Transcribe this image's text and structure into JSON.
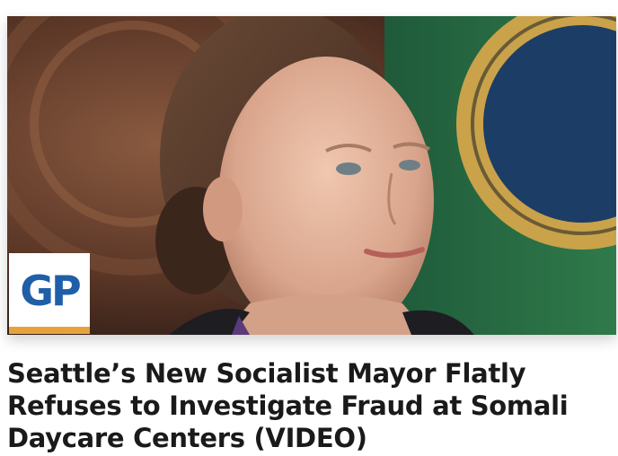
{
  "article": {
    "publisher_logo_text": "GP",
    "headline": "Seattle’s New Socialist Mayor Flatly Refuses to Investigate Fraud at Somali Daycare Centers (VIDEO)"
  },
  "colors": {
    "logo_blue": "#1f5fa8",
    "logo_accent": "#e6a23c",
    "headline_text": "#1a1a1a"
  }
}
